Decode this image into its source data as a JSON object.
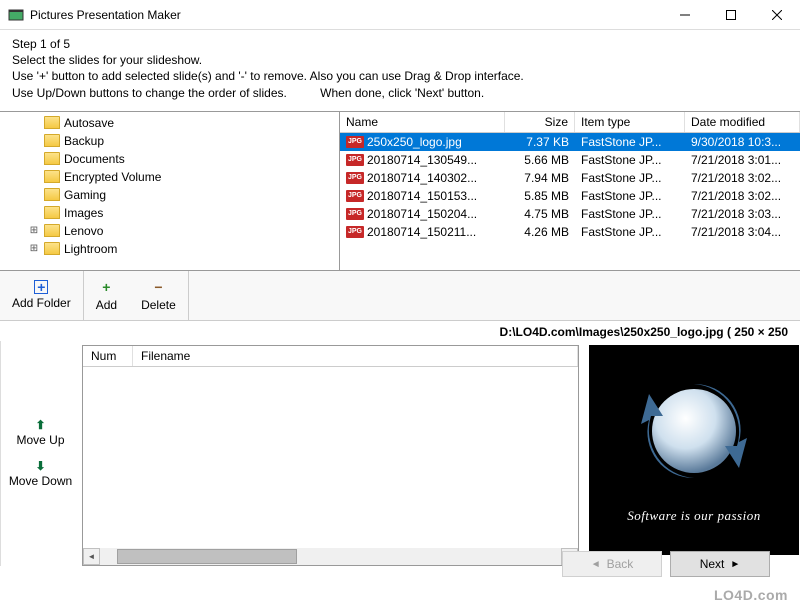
{
  "window": {
    "title": "Pictures Presentation Maker"
  },
  "instructions": {
    "step": "Step 1 of 5",
    "line1": "Select the slides for your slideshow.",
    "line2": "Use '+' button to add selected slide(s) and '-' to remove. Also you can use Drag & Drop interface.",
    "line3": "Use Up/Down buttons to change the order of slides.          When done, click 'Next' button."
  },
  "tree": [
    {
      "label": "Autosave",
      "expand": ""
    },
    {
      "label": "Backup",
      "expand": ""
    },
    {
      "label": "Documents",
      "expand": ""
    },
    {
      "label": "Encrypted Volume",
      "expand": ""
    },
    {
      "label": "Gaming",
      "expand": ""
    },
    {
      "label": "Images",
      "expand": ""
    },
    {
      "label": "Lenovo",
      "expand": "+"
    },
    {
      "label": "Lightroom",
      "expand": "+"
    }
  ],
  "file_headers": {
    "name": "Name",
    "size": "Size",
    "type": "Item type",
    "date": "Date modified"
  },
  "files": [
    {
      "name": "250x250_logo.jpg",
      "size": "7.37 KB",
      "type": "FastStone JP...",
      "date": "9/30/2018 10:3...",
      "selected": true
    },
    {
      "name": "20180714_130549...",
      "size": "5.66 MB",
      "type": "FastStone JP...",
      "date": "7/21/2018 3:01..."
    },
    {
      "name": "20180714_140302...",
      "size": "7.94 MB",
      "type": "FastStone JP...",
      "date": "7/21/2018 3:02..."
    },
    {
      "name": "20180714_150153...",
      "size": "5.85 MB",
      "type": "FastStone JP...",
      "date": "7/21/2018 3:02..."
    },
    {
      "name": "20180714_150204...",
      "size": "4.75 MB",
      "type": "FastStone JP...",
      "date": "7/21/2018 3:03..."
    },
    {
      "name": "20180714_150211...",
      "size": "4.26 MB",
      "type": "FastStone JP...",
      "date": "7/21/2018 3:04..."
    }
  ],
  "toolbar": {
    "add_folder": "Add Folder",
    "add": "Add",
    "delete": "Delete"
  },
  "path": "D:\\LO4D.com\\Images\\250x250_logo.jpg ( 250 × 250",
  "slide_headers": {
    "num": "Num",
    "filename": "Filename"
  },
  "move": {
    "up": "Move Up",
    "down": "Move Down"
  },
  "preview": {
    "tagline": "Software is our passion"
  },
  "nav": {
    "back": "Back",
    "next": "Next"
  },
  "watermark": "LO4D.com"
}
